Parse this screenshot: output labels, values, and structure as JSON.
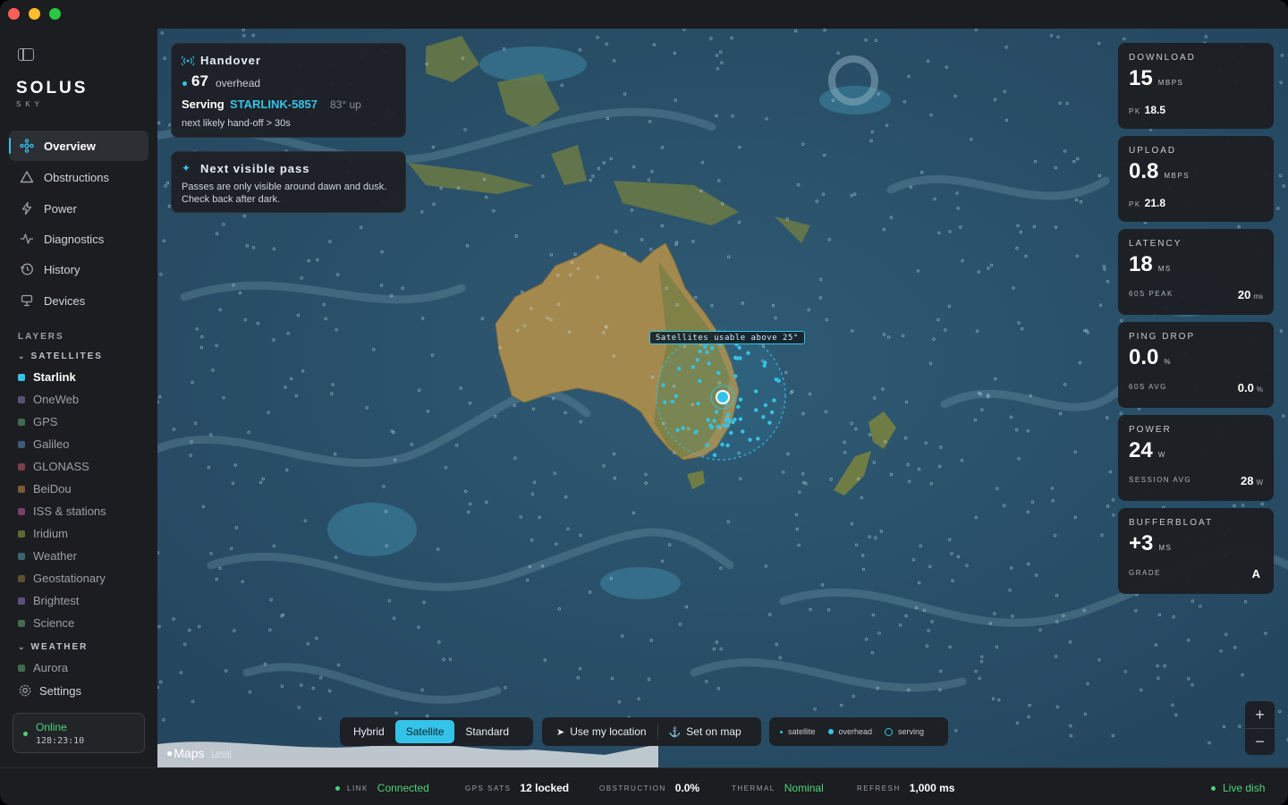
{
  "app": {
    "name": "SOLUS",
    "subtitle": "SKY"
  },
  "nav": [
    {
      "label": "Overview",
      "icon": "overview-icon",
      "active": true
    },
    {
      "label": "Obstructions",
      "icon": "obstruction-icon"
    },
    {
      "label": "Power",
      "icon": "power-bolt-icon"
    },
    {
      "label": "Diagnostics",
      "icon": "pulse-icon"
    },
    {
      "label": "History",
      "icon": "history-icon"
    },
    {
      "label": "Devices",
      "icon": "device-icon"
    }
  ],
  "layers": {
    "title": "LAYERS",
    "satellites_title": "SATELLITES",
    "satellites": [
      {
        "label": "Starlink",
        "color": "#34c3e8",
        "on": true
      },
      {
        "label": "OneWeb",
        "color": "#5a4f7a"
      },
      {
        "label": "GPS",
        "color": "#3f6b50"
      },
      {
        "label": "Galileo",
        "color": "#3d5a7a"
      },
      {
        "label": "GLONASS",
        "color": "#7a3f48"
      },
      {
        "label": "BeiDou",
        "color": "#7a5a30"
      },
      {
        "label": "ISS & stations",
        "color": "#7a3f66"
      },
      {
        "label": "Iridium",
        "color": "#5c6a30"
      },
      {
        "label": "Weather",
        "color": "#3a6670"
      },
      {
        "label": "Geostationary",
        "color": "#5c5030"
      },
      {
        "label": "Brightest",
        "color": "#5a4f7a"
      },
      {
        "label": "Science",
        "color": "#3f6b50"
      }
    ],
    "weather_title": "WEATHER",
    "weather": [
      {
        "label": "Aurora",
        "color": "#3f6b50"
      }
    ]
  },
  "settings_label": "Settings",
  "status": {
    "state": "Online",
    "uptime": "128:23:10"
  },
  "handover": {
    "title": "Handover",
    "count": "67",
    "count_label": "overhead",
    "serving_label": "Serving",
    "serving_sat": "STARLINK-5857",
    "elevation": "83° up",
    "note": "next likely hand-off > 30s"
  },
  "next_pass": {
    "title": "Next visible pass",
    "body": "Passes are only visible around dawn and dusk. Check back after dark."
  },
  "map_tooltip": "Satellites usable above 25°",
  "stats": [
    {
      "label": "DOWNLOAD",
      "value": "15",
      "unit": "MBPS",
      "foot_label": "PK",
      "foot_value": "18.5"
    },
    {
      "label": "UPLOAD",
      "value": "0.8",
      "unit": "MBPS",
      "foot_label": "PK",
      "foot_value": "21.8"
    },
    {
      "label": "LATENCY",
      "value": "18",
      "unit": "MS",
      "foot_label": "60S PEAK",
      "right_value": "20",
      "right_unit": "ms"
    },
    {
      "label": "PING DROP",
      "value": "0.0",
      "unit": "%",
      "foot_label": "60S AVG",
      "right_value": "0.0",
      "right_unit": "%"
    },
    {
      "label": "POWER",
      "value": "24",
      "unit": "W",
      "foot_label": "SESSION AVG",
      "right_value": "28",
      "right_unit": "W"
    },
    {
      "label": "BUFFERBLOAT",
      "value": "+3",
      "unit": "MS",
      "foot_label": "GRADE",
      "right_value": "A",
      "right_unit": ""
    }
  ],
  "map_modes": {
    "hybrid": "Hybrid",
    "satellite": "Satellite",
    "standard": "Standard",
    "selected": "Satellite"
  },
  "location": {
    "use": "Use my location",
    "set": "Set on map"
  },
  "legend": {
    "satellite": "satellite",
    "overhead": "overhead",
    "serving": "serving"
  },
  "attribution": {
    "maps": "Maps",
    "legal": "Legal"
  },
  "zoom": {
    "in": "+",
    "out": "−"
  },
  "bottom": {
    "link_label": "LINK",
    "link_value": "Connected",
    "gps_label": "GPS SATS",
    "gps_value": "12 locked",
    "obstruction_label": "OBSTRUCTION",
    "obstruction_value": "0.0%",
    "thermal_label": "THERMAL",
    "thermal_value": "Nominal",
    "refresh_label": "REFRESH",
    "refresh_value": "1,000 ms",
    "live_label": "Live dish"
  }
}
